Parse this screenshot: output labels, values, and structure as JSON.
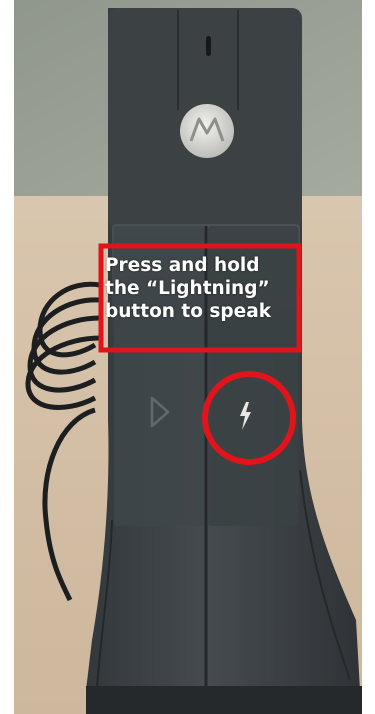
{
  "image": {
    "subject": "Desk microphone push-to-talk base",
    "icons": [
      "brand-logo-icon",
      "speaker-icon",
      "lightning-bolt-icon"
    ],
    "colors": {
      "background_wall": "#9aa194",
      "desk": "#d6c2a9",
      "device_body": "#3f4448",
      "device_dark": "#2b2f32",
      "highlight": "#e0141a",
      "caption_text": "#ffffff"
    }
  },
  "annotation": {
    "lines": [
      "Press and hold",
      "the “Lightning”",
      "button to speak"
    ]
  }
}
